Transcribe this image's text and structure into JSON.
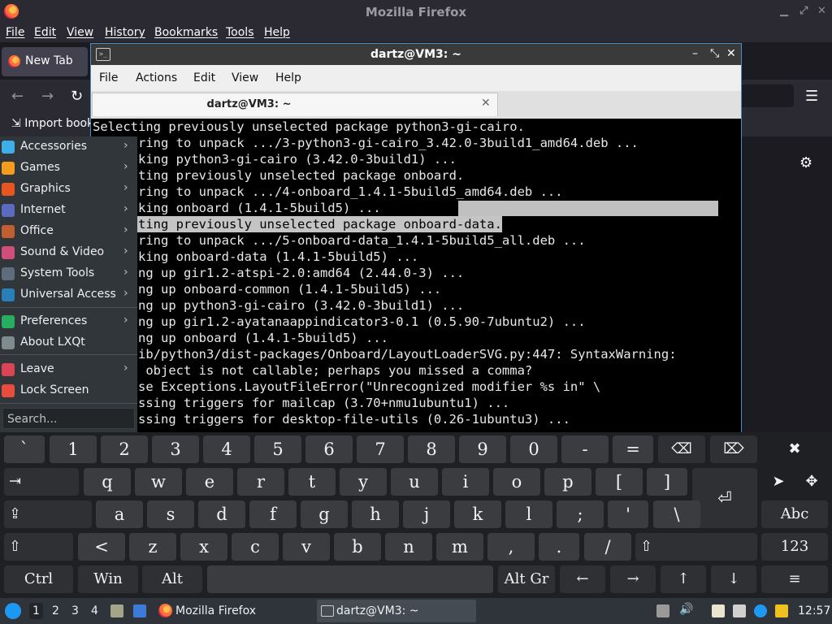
{
  "firefox": {
    "title": "Mozilla Firefox",
    "menu": [
      "File",
      "Edit",
      "View",
      "History",
      "Bookmarks",
      "Tools",
      "Help"
    ],
    "tab_label": "New Tab",
    "bookmark_label": "Import book"
  },
  "terminal": {
    "title": "dartz@VM3: ~",
    "menu": [
      "File",
      "Actions",
      "Edit",
      "View",
      "Help"
    ],
    "tab_label": "dartz@VM3: ~",
    "lines": [
      "Selecting previously unselected package python3-gi-cairo.",
      "      ring to unpack .../3-python3-gi-cairo_3.42.0-3build1_amd64.deb ...",
      "      king python3-gi-cairo (3.42.0-3build1) ...",
      "      ting previously unselected package onboard.",
      "      ring to unpack .../4-onboard_1.4.1-5build5_amd64.deb ...",
      "      king onboard (1.4.1-5build5) ...",
      "      ting previously unselected package onboard-data.",
      "      ring to unpack .../5-onboard-data_1.4.1-5build5_all.deb ...",
      "      king onboard-data (1.4.1-5build5) ...",
      "      ng up gir1.2-atspi-2.0:amd64 (2.44.0-3) ...",
      "      ng up onboard-common (1.4.1-5build5) ...",
      "      ng up python3-gi-cairo (3.42.0-3build1) ...",
      "      ng up gir1.2-ayatanaappindicator3-0.1 (0.5.90-7ubuntu2) ...",
      "      ng up onboard (1.4.1-5build5) ...",
      "      ib/python3/dist-packages/Onboard/LayoutLoaderSVG.py:447: SyntaxWarning:",
      "       object is not callable; perhaps you missed a comma?",
      "      se Exceptions.LayoutFileError(\"Unrecognized modifier %s in\" \\",
      "      ssing triggers for mailcap (3.70+nmu1ubuntu1) ...",
      "      ssing triggers for desktop-file-utils (0.26-1ubuntu3) ..."
    ]
  },
  "startmenu": {
    "items": [
      {
        "label": "Accessories",
        "color": "#3daee9"
      },
      {
        "label": "Games",
        "color": "#f39c1f"
      },
      {
        "label": "Graphics",
        "color": "#e95420"
      },
      {
        "label": "Internet",
        "color": "#5c6bc0"
      },
      {
        "label": "Office",
        "color": "#c06030"
      },
      {
        "label": "Sound & Video",
        "color": "#d04f7a"
      },
      {
        "label": "System Tools",
        "color": "#5d6d7e"
      },
      {
        "label": "Universal Access",
        "color": "#2980b9"
      },
      {
        "label": "Preferences",
        "color": "#27ae60"
      },
      {
        "label": "About LXQt",
        "color": "#7f8c8d"
      },
      {
        "label": "Leave",
        "color": "#da4453"
      },
      {
        "label": "Lock Screen",
        "color": "#e74c3c"
      }
    ],
    "search_placeholder": "Search..."
  },
  "keyboard": {
    "row1": [
      "`",
      "1",
      "2",
      "3",
      "4",
      "5",
      "6",
      "7",
      "8",
      "9",
      "0",
      "-",
      "=",
      "⌫",
      "⌦",
      "✖"
    ],
    "row2": [
      "⇥",
      "q",
      "w",
      "e",
      "r",
      "t",
      "y",
      "u",
      "i",
      "o",
      "p",
      "[",
      "]",
      "⏎",
      "pointer",
      "✥"
    ],
    "row3": [
      "⇪",
      "a",
      "s",
      "d",
      "f",
      "g",
      "h",
      "j",
      "k",
      "l",
      ";",
      "'",
      "\\",
      "Abc"
    ],
    "row4": [
      "⇧",
      "<",
      "z",
      "x",
      "c",
      "v",
      "b",
      "n",
      "m",
      ",",
      ".",
      "/",
      "⇧",
      "123"
    ],
    "row5": [
      "Ctrl",
      "Win",
      "Alt",
      "",
      "Alt Gr",
      "←",
      "→",
      "↑",
      "↓",
      "≡"
    ]
  },
  "taskbar": {
    "desktops": [
      "1",
      "2",
      "3",
      "4"
    ],
    "tasks": [
      "Mozilla Firefox",
      "dartz@VM3: ~"
    ],
    "clock": "12:57"
  }
}
